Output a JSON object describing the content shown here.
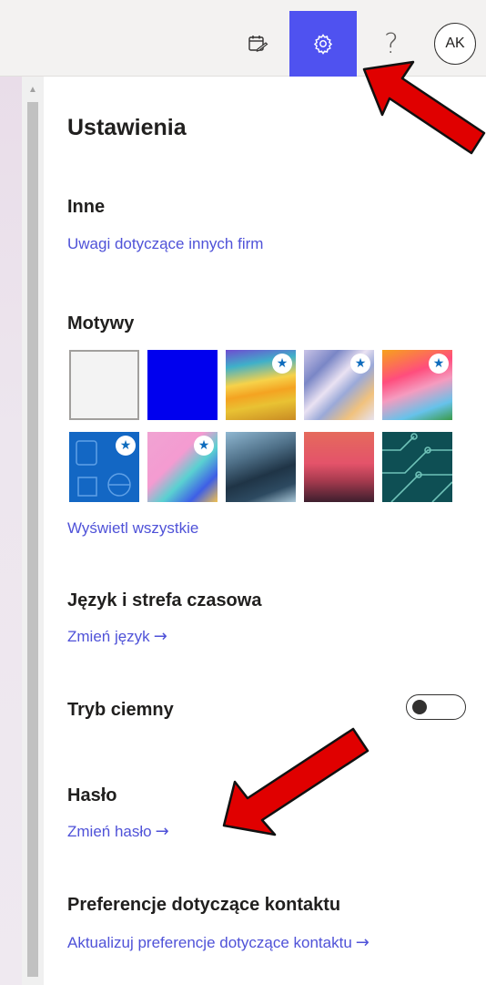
{
  "topbar": {
    "help_glyph": "?",
    "avatar_initials": "AK",
    "active_color": "#4f52f0",
    "icons": [
      "calendar-check-icon",
      "gear-icon",
      "help-icon"
    ]
  },
  "panel": {
    "title": "Ustawienia",
    "other": {
      "heading": "Inne",
      "link": "Uwagi dotyczące innych firm"
    },
    "themes": {
      "heading": "Motywy",
      "view_all": "Wyświetl wszystkie"
    },
    "language": {
      "heading": "Język i strefa czasowa",
      "link": "Zmień język"
    },
    "dark_mode": {
      "label": "Tryb ciemny",
      "enabled": false
    },
    "password": {
      "heading": "Hasło",
      "link": "Zmień hasło"
    },
    "contact": {
      "heading": "Preferencje dotyczące kontaktu",
      "link": "Aktualizuj preferencje dotyczące kontaktu"
    },
    "arrow_glyph": "→",
    "star_glyph": "★",
    "link_color": "#4f52d8"
  },
  "annotations": {
    "arrow_color": "#e00000"
  }
}
